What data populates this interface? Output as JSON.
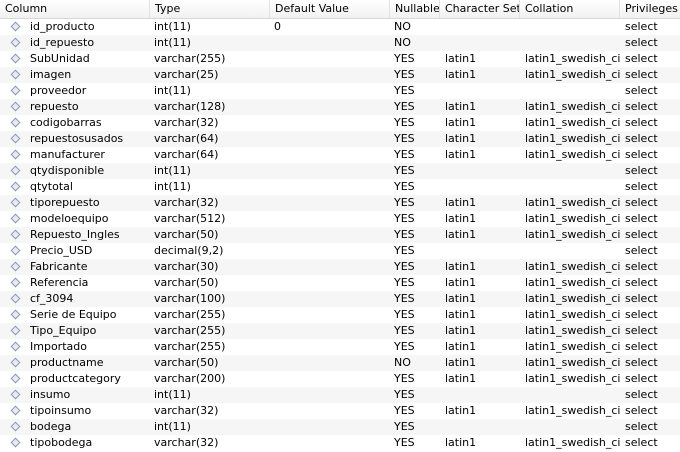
{
  "header": {
    "column": "Column",
    "type": "Type",
    "default": "Default Value",
    "nullable": "Nullable",
    "charset": "Character Set",
    "collation": "Collation",
    "privileges": "Privileges"
  },
  "rows": [
    {
      "name": "id_producto",
      "type": "int(11)",
      "default": "0",
      "nullable": "NO",
      "charset": "",
      "collation": "",
      "privileges": "select"
    },
    {
      "name": "id_repuesto",
      "type": "int(11)",
      "default": "",
      "nullable": "NO",
      "charset": "",
      "collation": "",
      "privileges": "select"
    },
    {
      "name": "SubUnidad",
      "type": "varchar(255)",
      "default": "",
      "nullable": "YES",
      "charset": "latin1",
      "collation": "latin1_swedish_ci",
      "privileges": "select"
    },
    {
      "name": "imagen",
      "type": "varchar(25)",
      "default": "",
      "nullable": "YES",
      "charset": "latin1",
      "collation": "latin1_swedish_ci",
      "privileges": "select"
    },
    {
      "name": "proveedor",
      "type": "int(11)",
      "default": "",
      "nullable": "YES",
      "charset": "",
      "collation": "",
      "privileges": "select"
    },
    {
      "name": "repuesto",
      "type": "varchar(128)",
      "default": "",
      "nullable": "YES",
      "charset": "latin1",
      "collation": "latin1_swedish_ci",
      "privileges": "select"
    },
    {
      "name": "codigobarras",
      "type": "varchar(32)",
      "default": "",
      "nullable": "YES",
      "charset": "latin1",
      "collation": "latin1_swedish_ci",
      "privileges": "select"
    },
    {
      "name": "repuestosusados",
      "type": "varchar(64)",
      "default": "",
      "nullable": "YES",
      "charset": "latin1",
      "collation": "latin1_swedish_ci",
      "privileges": "select"
    },
    {
      "name": "manufacturer",
      "type": "varchar(64)",
      "default": "",
      "nullable": "YES",
      "charset": "latin1",
      "collation": "latin1_swedish_ci",
      "privileges": "select"
    },
    {
      "name": "qtydisponible",
      "type": "int(11)",
      "default": "",
      "nullable": "YES",
      "charset": "",
      "collation": "",
      "privileges": "select"
    },
    {
      "name": "qtytotal",
      "type": "int(11)",
      "default": "",
      "nullable": "YES",
      "charset": "",
      "collation": "",
      "privileges": "select"
    },
    {
      "name": "tiporepuesto",
      "type": "varchar(32)",
      "default": "",
      "nullable": "YES",
      "charset": "latin1",
      "collation": "latin1_swedish_ci",
      "privileges": "select"
    },
    {
      "name": "modeloequipo",
      "type": "varchar(512)",
      "default": "",
      "nullable": "YES",
      "charset": "latin1",
      "collation": "latin1_swedish_ci",
      "privileges": "select"
    },
    {
      "name": "Repuesto_Ingles",
      "type": "varchar(50)",
      "default": "",
      "nullable": "YES",
      "charset": "latin1",
      "collation": "latin1_swedish_ci",
      "privileges": "select"
    },
    {
      "name": "Precio_USD",
      "type": "decimal(9,2)",
      "default": "",
      "nullable": "YES",
      "charset": "",
      "collation": "",
      "privileges": "select"
    },
    {
      "name": "Fabricante",
      "type": "varchar(30)",
      "default": "",
      "nullable": "YES",
      "charset": "latin1",
      "collation": "latin1_swedish_ci",
      "privileges": "select"
    },
    {
      "name": "Referencia",
      "type": "varchar(50)",
      "default": "",
      "nullable": "YES",
      "charset": "latin1",
      "collation": "latin1_swedish_ci",
      "privileges": "select"
    },
    {
      "name": "cf_3094",
      "type": "varchar(100)",
      "default": "",
      "nullable": "YES",
      "charset": "latin1",
      "collation": "latin1_swedish_ci",
      "privileges": "select"
    },
    {
      "name": "Serie de Equipo",
      "type": "varchar(255)",
      "default": "",
      "nullable": "YES",
      "charset": "latin1",
      "collation": "latin1_swedish_ci",
      "privileges": "select"
    },
    {
      "name": "Tipo_Equipo",
      "type": "varchar(255)",
      "default": "",
      "nullable": "YES",
      "charset": "latin1",
      "collation": "latin1_swedish_ci",
      "privileges": "select"
    },
    {
      "name": "Importado",
      "type": "varchar(255)",
      "default": "",
      "nullable": "YES",
      "charset": "latin1",
      "collation": "latin1_swedish_ci",
      "privileges": "select"
    },
    {
      "name": "productname",
      "type": "varchar(50)",
      "default": "",
      "nullable": "NO",
      "charset": "latin1",
      "collation": "latin1_swedish_ci",
      "privileges": "select"
    },
    {
      "name": "productcategory",
      "type": "varchar(200)",
      "default": "",
      "nullable": "YES",
      "charset": "latin1",
      "collation": "latin1_swedish_ci",
      "privileges": "select"
    },
    {
      "name": "insumo",
      "type": "int(11)",
      "default": "",
      "nullable": "YES",
      "charset": "",
      "collation": "",
      "privileges": "select"
    },
    {
      "name": "tipoinsumo",
      "type": "varchar(32)",
      "default": "",
      "nullable": "YES",
      "charset": "latin1",
      "collation": "latin1_swedish_ci",
      "privileges": "select"
    },
    {
      "name": "bodega",
      "type": "int(11)",
      "default": "",
      "nullable": "YES",
      "charset": "",
      "collation": "",
      "privileges": "select"
    },
    {
      "name": "tipobodega",
      "type": "varchar(32)",
      "default": "",
      "nullable": "YES",
      "charset": "latin1",
      "collation": "latin1_swedish_ci",
      "privileges": "select"
    }
  ]
}
